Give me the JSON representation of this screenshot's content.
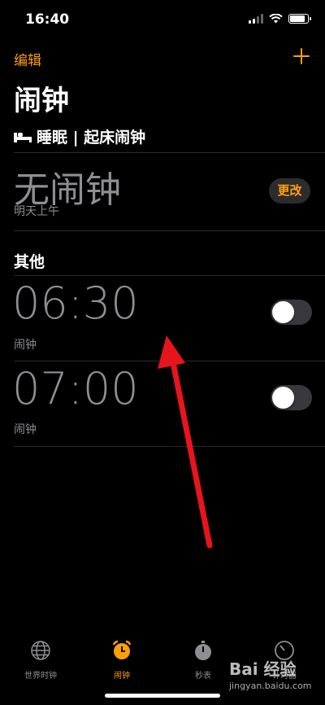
{
  "status_bar": {
    "time": "16:40",
    "battery_level": 0.85
  },
  "nav": {
    "edit_label": "编辑"
  },
  "page_title": "闹钟",
  "sleep": {
    "header": "睡眠 | 起床闹钟",
    "value": "无闹钟",
    "sub": "明天上午",
    "change_label": "更改"
  },
  "section_title": "其他",
  "alarms": [
    {
      "time": "06:30",
      "label": "闹钟",
      "enabled": false
    },
    {
      "time": "07:00",
      "label": "闹钟",
      "enabled": false
    }
  ],
  "tabs": [
    {
      "label": "世界时钟",
      "icon": "globe-icon",
      "active": false
    },
    {
      "label": "闹钟",
      "icon": "alarm-clock-icon",
      "active": true
    },
    {
      "label": "秒表",
      "icon": "stopwatch-icon",
      "active": false
    },
    {
      "label": "计时器",
      "icon": "timer-icon",
      "active": false
    }
  ],
  "colors": {
    "accent": "#ff9f0a",
    "background": "#000000",
    "secondary_text": "#8e8e93",
    "arrow": "#e8141c"
  },
  "watermark": {
    "brand": "Bai 经验",
    "url": "jingyan.baidu.com"
  }
}
